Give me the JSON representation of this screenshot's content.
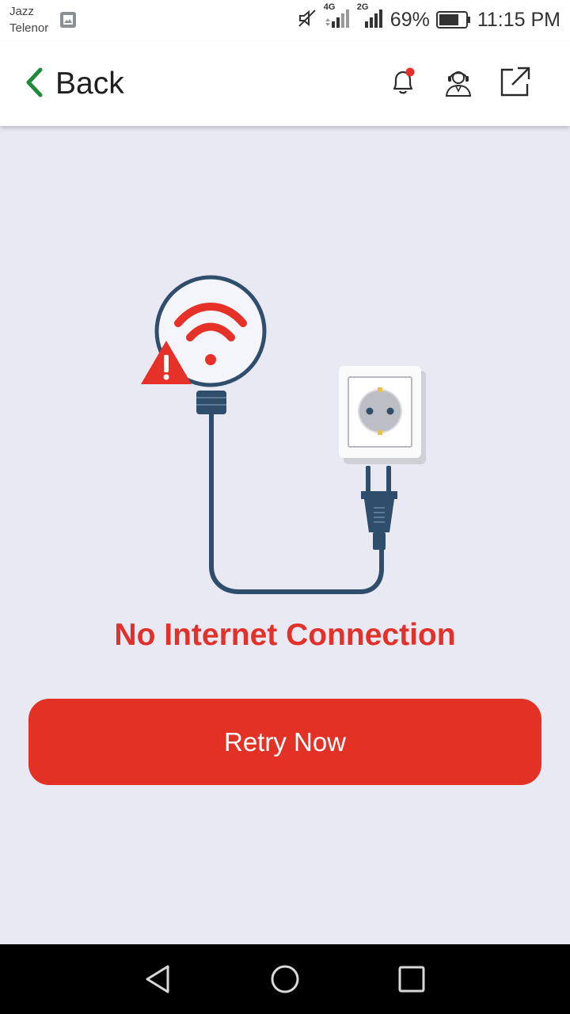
{
  "status_bar": {
    "carrier_1": "Jazz",
    "carrier_2": "Telenor",
    "network_1": "4G",
    "network_2": "2G",
    "battery": "69%",
    "time": "11:15 PM"
  },
  "header": {
    "back_label": "Back",
    "icons": [
      "notification-bell-icon",
      "support-agent-icon",
      "external-link-icon"
    ],
    "accent_color": "#1e8a3c",
    "notification_dot_color": "#e8302a"
  },
  "main": {
    "error_title": "No Internet Connection",
    "retry_label": "Retry Now",
    "brand_color": "#e33225"
  },
  "nav_bar": {
    "icons": [
      "back-triangle-icon",
      "home-circle-icon",
      "recents-square-icon"
    ]
  }
}
